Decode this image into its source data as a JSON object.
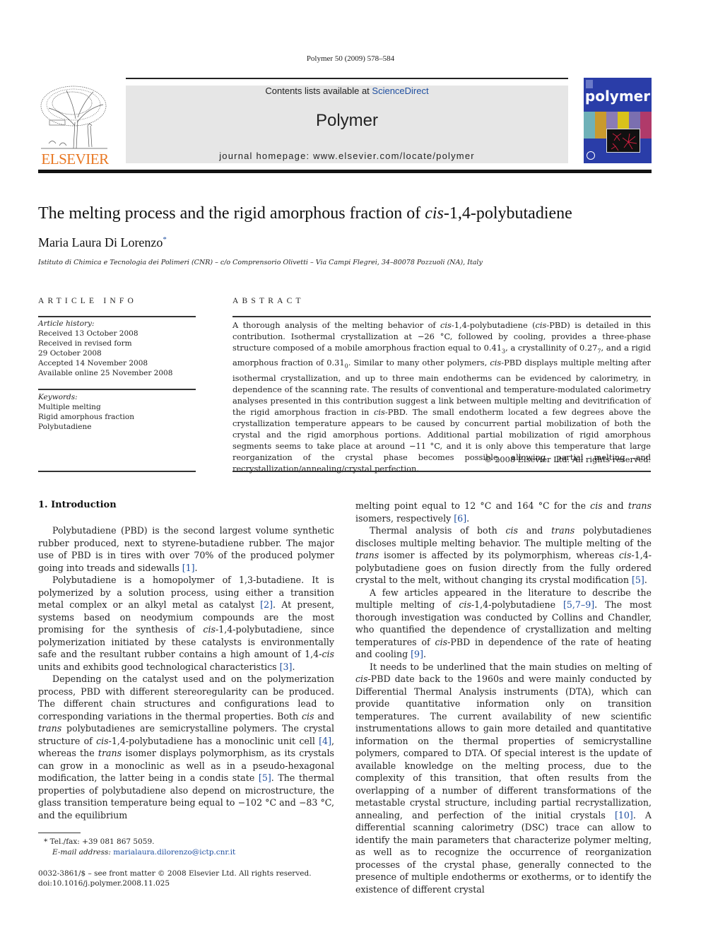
{
  "header": {
    "citation": "Polymer 50 (2009) 578–584",
    "contents_prefix": "Contents lists available at ",
    "sciencedirect": "ScienceDirect",
    "journal_title": "Polymer",
    "homepage": "journal homepage: www.elsevier.com/locate/polymer",
    "publisher_logo": "ELSEVIER",
    "cover_title": "polymer"
  },
  "article": {
    "title_pre": "The melting process and the rigid amorphous fraction of ",
    "title_italic": "cis",
    "title_post": "-1,4-polybutadiene",
    "author": "Maria Laura Di Lorenzo",
    "author_mark": "*",
    "affiliation": "Istituto di Chimica e Tecnologia dei Polimeri (CNR) – c/o Comprensorio Olivetti – Via Campi Flegrei, 34–80078 Pozzuoli (NA), Italy"
  },
  "article_info": {
    "heading": "ARTICLE INFO",
    "history_label": "Article history:",
    "history": [
      "Received 13 October 2008",
      "Received in revised form",
      "29 October 2008",
      "Accepted 14 November 2008",
      "Available online 25 November 2008"
    ],
    "keywords_label": "Keywords:",
    "keywords": [
      "Multiple melting",
      "Rigid amorphous fraction",
      "Polybutadiene"
    ]
  },
  "abstract": {
    "heading": "ABSTRACT",
    "copyright": "© 2008 Elsevier Ltd. All rights reserved."
  },
  "introduction": {
    "heading": "1.  Introduction"
  },
  "footnote": {
    "tel": "*  Tel./fax: +39 081 867 5059.",
    "email_label": "E-mail address: ",
    "email": "marialaura.dilorenzo@ictp.cnr.it",
    "issn": "0032-3861/$ – see front matter © 2008 Elsevier Ltd. All rights reserved.",
    "doi": "doi:10.1016/j.polymer.2008.11.025"
  },
  "colors": {
    "link_blue": "#1f4fa0",
    "elsevier_orange": "#e87722",
    "banner_gray": "#e6e6e6",
    "cover_blue": "#2a3da8"
  }
}
